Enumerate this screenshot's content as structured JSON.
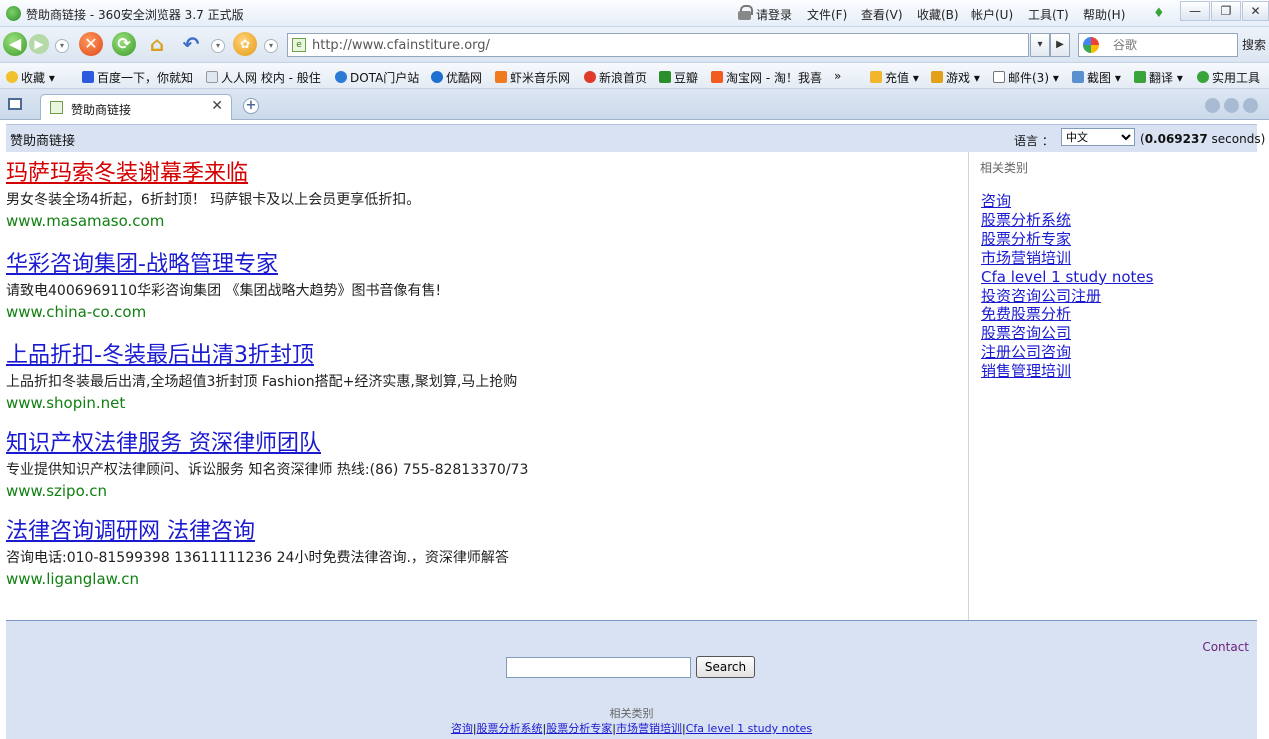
{
  "window": {
    "title": "赞助商链接 - 360安全浏览器 3.7 正式版",
    "login": "请登录",
    "menus": [
      "文件(F)",
      "查看(V)",
      "收藏(B)",
      "帐户(U)",
      "工具(T)",
      "帮助(H)"
    ],
    "controls": [
      "—",
      "❐",
      "✕"
    ]
  },
  "nav": {
    "url": "http://www.cfainstiture.org/",
    "search_placeholder": "谷歌",
    "search_button": "搜索"
  },
  "favorites": [
    "收藏",
    "百度一下，你就知",
    "人人网 校内 - 般住",
    "DOTA门户站",
    "优酷网",
    "虾米音乐网",
    "新浪首页",
    "豆瓣",
    "淘宝网 - 淘！我喜",
    "»",
    "充值",
    "游戏",
    "邮件(3)",
    "截图",
    "翻译",
    "实用工具"
  ],
  "tab": {
    "label": "赞助商链接",
    "close": "✕",
    "new": "+"
  },
  "page": {
    "header_title": "赞助商链接",
    "language_label": "语言 ：",
    "language_value": "中文",
    "timing_open": "(",
    "timing_value": "0.069237",
    "timing_unit": " seconds)",
    "ads": [
      {
        "title": "玛萨玛索冬装谢幕季来临",
        "desc": "男女冬装全场4折起，6折封顶！ 玛萨银卡及以上会员更享低折扣。",
        "url": "www.masamaso.com"
      },
      {
        "title": "华彩咨询集团-战略管理专家",
        "desc": "请致电4006969110华彩咨询集团 《集团战略大趋势》图书音像有售!",
        "url": "www.china-co.com"
      },
      {
        "title": "上品折扣-冬装最后出清3折封顶",
        "desc": "上品折扣冬装最后出清,全场超值3折封顶 Fashion搭配+经济实惠,聚划算,马上抢购",
        "url": "www.shopin.net"
      },
      {
        "title": "知识产权法律服务 资深律师团队",
        "desc": "专业提供知识产权法律顾问、诉讼服务 知名资深律师 热线:(86) 755-82813370/73",
        "url": "www.szipo.cn"
      },
      {
        "title": "法律咨询调研网 法律咨询",
        "desc": "咨询电话:010-81599398 13611111236 24小时免费法律咨询.，资深律师解答",
        "url": "www.liganglaw.cn"
      }
    ],
    "related_title": "相关类别",
    "related": [
      "咨询",
      "股票分析系统",
      "股票分析专家",
      "市场营销培训",
      "Cfa level 1 study notes",
      "投资咨询公司注册",
      "免费股票分析",
      "股票咨询公司",
      "注册公司咨询",
      "销售管理培训"
    ],
    "footer": {
      "contact": "Contact",
      "search_button": "Search",
      "search_value": "",
      "related_title": "相关类别",
      "links": [
        "咨询",
        "股票分析系统",
        "股票分析专家",
        "市场营销培训",
        "Cfa level 1 study notes"
      ],
      "separator": "|"
    }
  },
  "colors": {
    "link": "#1a1ad0",
    "visited_link": "#d40000",
    "url_green": "#118011",
    "header_bg": "#d9e2f2",
    "contact": "#6b1f7a"
  }
}
